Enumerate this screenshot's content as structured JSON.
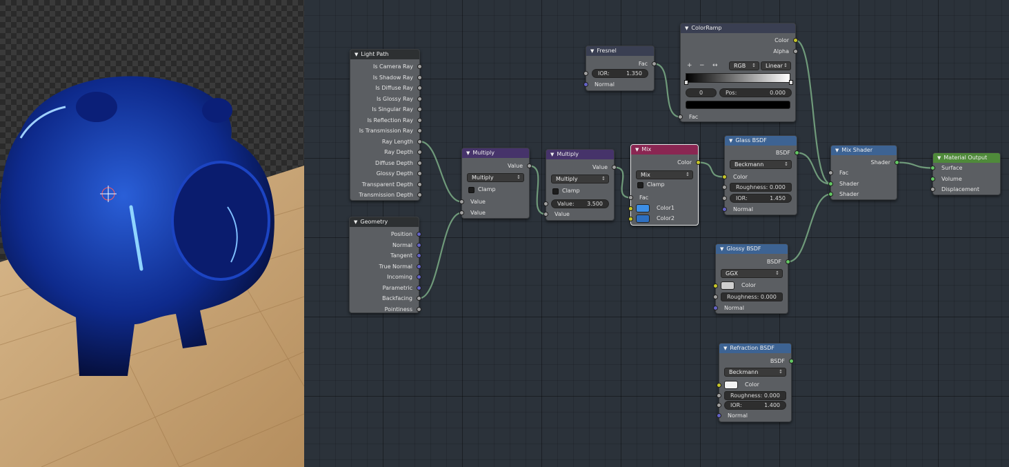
{
  "render": {
    "subject": "blue glass piggy bank on wooden floor"
  },
  "nodes": {
    "light_path": {
      "title": "Light Path",
      "outputs": [
        "Is Camera Ray",
        "Is Shadow Ray",
        "Is Diffuse Ray",
        "Is Glossy Ray",
        "Is Singular Ray",
        "Is Reflection Ray",
        "Is Transmission Ray",
        "Ray Length",
        "Ray Depth",
        "Diffuse Depth",
        "Glossy Depth",
        "Transparent Depth",
        "Transmission Depth"
      ]
    },
    "geometry": {
      "title": "Geometry",
      "outputs": [
        "Position",
        "Normal",
        "Tangent",
        "True Normal",
        "Incoming",
        "Parametric",
        "Backfacing",
        "Pointiness"
      ]
    },
    "fresnel": {
      "title": "Fresnel",
      "out": "Fac",
      "ior_label": "IOR:",
      "ior": "1.350",
      "normal": "Normal"
    },
    "colorramp": {
      "title": "ColorRamp",
      "out_color": "Color",
      "out_alpha": "Alpha",
      "mode": "RGB",
      "interp": "Linear",
      "index": "0",
      "pos_label": "Pos:",
      "pos": "0.000",
      "in_fac": "Fac",
      "plus": "+",
      "minus": "−",
      "flip": "↔"
    },
    "multiply1": {
      "title": "Multiply",
      "out": "Value",
      "op": "Multiply",
      "clamp": "Clamp",
      "in1": "Value",
      "in2": "Value"
    },
    "multiply2": {
      "title": "Multiply",
      "out": "Value",
      "op": "Multiply",
      "clamp": "Clamp",
      "value_label": "Value:",
      "value": "3.500",
      "in2": "Value"
    },
    "mix": {
      "title": "Mix",
      "out": "Color",
      "blend": "Mix",
      "clamp": "Clamp",
      "fac": "Fac",
      "color1": "Color1",
      "color2": "Color2"
    },
    "glass": {
      "title": "Glass BSDF",
      "out": "BSDF",
      "dist": "Beckmann",
      "color": "Color",
      "rough_label": "Roughness:",
      "rough": "0.000",
      "ior_label": "IOR:",
      "ior": "1.450",
      "normal": "Normal"
    },
    "glossy": {
      "title": "Glossy BSDF",
      "out": "BSDF",
      "dist": "GGX",
      "color": "Color",
      "rough_label": "Roughness:",
      "rough": "0.000",
      "normal": "Normal"
    },
    "refraction": {
      "title": "Refraction BSDF",
      "out": "BSDF",
      "dist": "Beckmann",
      "color": "Color",
      "rough_label": "Roughness:",
      "rough": "0.000",
      "ior_label": "IOR:",
      "ior": "1.400",
      "normal": "Normal"
    },
    "mixshader": {
      "title": "Mix Shader",
      "out": "Shader",
      "fac": "Fac",
      "sh1": "Shader",
      "sh2": "Shader"
    },
    "output": {
      "title": "Material Output",
      "surface": "Surface",
      "volume": "Volume",
      "displacement": "Displacement"
    }
  },
  "colors": {
    "socket_value": "#a1a1a1",
    "socket_vector": "#6363c7",
    "socket_color": "#c7c729",
    "socket_shader": "#63c763",
    "mix_color1": "#3d8fe6",
    "mix_color2": "#2e6fc0",
    "glossy_color": "#cfcfcf",
    "refraction_color": "#f2f2f2",
    "glass_color": "#3a3a3a"
  }
}
